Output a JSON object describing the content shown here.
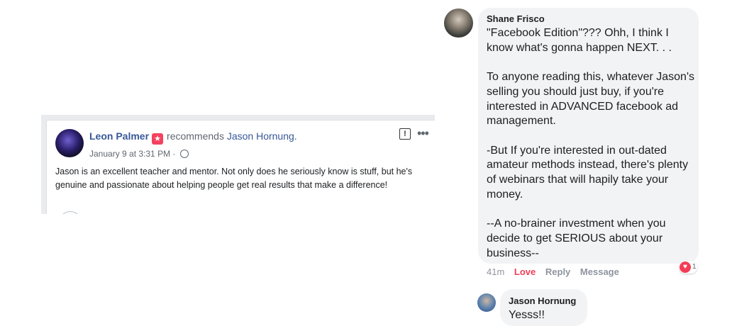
{
  "recommendation": {
    "author": "Leon Palmer",
    "verb": "recommends",
    "target": "Jason Hornung.",
    "timestamp": "January 9 at 3:31 PM · ",
    "text": "Jason is an excellent teacher and mentor. Not only does he seriously know is stuff, but he's genuine and passionate about helping people get real results that make a difference!"
  },
  "comment": {
    "author": "Shane Frisco",
    "paragraphs": [
      "\"Facebook Edition\"??? Ohh, I think I know what's gonna happen NEXT. . .",
      "To anyone reading this, whatever Jason's selling you should just buy, if you're interested in ADVANCED facebook ad management.",
      "-But If you're interested in out-dated amateur methods instead, there's plenty of webinars that will hapily take your money.",
      "--A no-brainer investment when you decide to get SERIOUS about your business--"
    ],
    "time": "41m",
    "actions": {
      "love": "Love",
      "reply": "Reply",
      "message": "Message"
    },
    "reaction_count": "1"
  },
  "reply": {
    "author": "Jason Hornung",
    "text": "Yesss!!"
  },
  "icons": {
    "report": "report-icon",
    "more": "more-options-icon",
    "globe": "globe-icon",
    "heart": "heart-reaction-icon"
  }
}
